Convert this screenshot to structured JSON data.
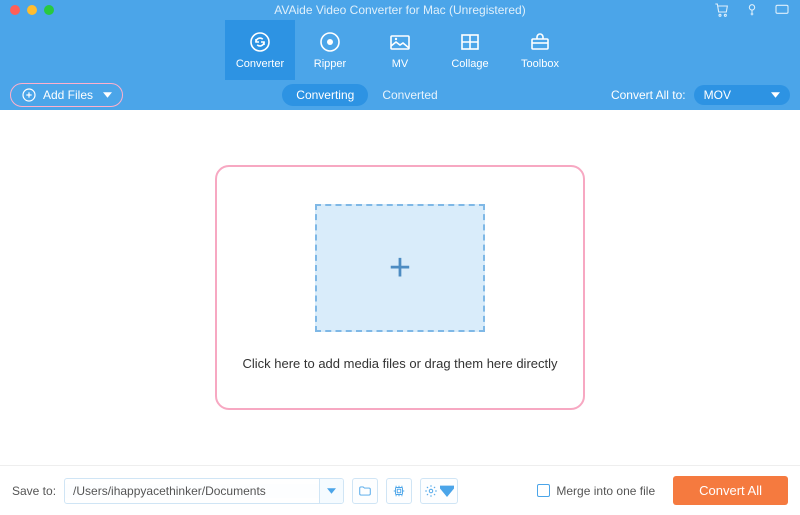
{
  "window": {
    "title": "AVAide Video Converter for Mac (Unregistered)"
  },
  "nav": {
    "items": [
      {
        "label": "Converter",
        "active": true
      },
      {
        "label": "Ripper",
        "active": false
      },
      {
        "label": "MV",
        "active": false
      },
      {
        "label": "Collage",
        "active": false
      },
      {
        "label": "Toolbox",
        "active": false
      }
    ]
  },
  "subbar": {
    "add_files_label": "Add Files",
    "tabs": {
      "converting": "Converting",
      "converted": "Converted"
    },
    "convert_all_to_label": "Convert All to:",
    "format": "MOV"
  },
  "dropzone": {
    "hint": "Click here to add media files or drag them here directly"
  },
  "bottom": {
    "save_to_label": "Save to:",
    "save_to_path": "/Users/ihappyacethinker/Documents",
    "merge_label": "Merge into one file",
    "convert_all_btn": "Convert All"
  }
}
